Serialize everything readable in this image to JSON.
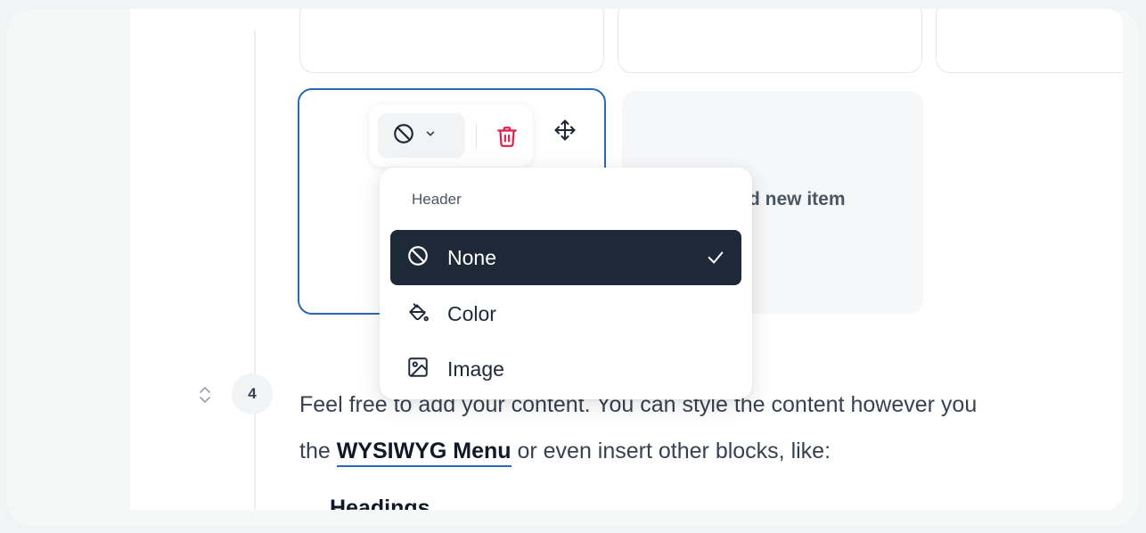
{
  "grid": {
    "add_item_label": "d new item"
  },
  "toolbar": {
    "none_icon": "ban-icon",
    "chevron_icon": "chevron-down-icon",
    "trash_icon": "trash-icon",
    "move_icon": "move-icon"
  },
  "dropdown": {
    "header": "Header",
    "items": [
      {
        "label": "None",
        "icon": "ban-icon",
        "selected": true
      },
      {
        "label": "Color",
        "icon": "paint-bucket-icon",
        "selected": false
      },
      {
        "label": "Image",
        "icon": "image-icon",
        "selected": false
      }
    ]
  },
  "block": {
    "number": "4",
    "text_line1": "Feel free to add your content. You can style the content however you",
    "text_line2_before": "the ",
    "text_line2_link": "WYSIWYG Menu",
    "text_line2_after": " or even insert other blocks, like:",
    "bullet": "Headings"
  },
  "colors": {
    "accent": "#2a69b6",
    "selected_bg": "#1e2937",
    "danger": "#e11d48"
  }
}
